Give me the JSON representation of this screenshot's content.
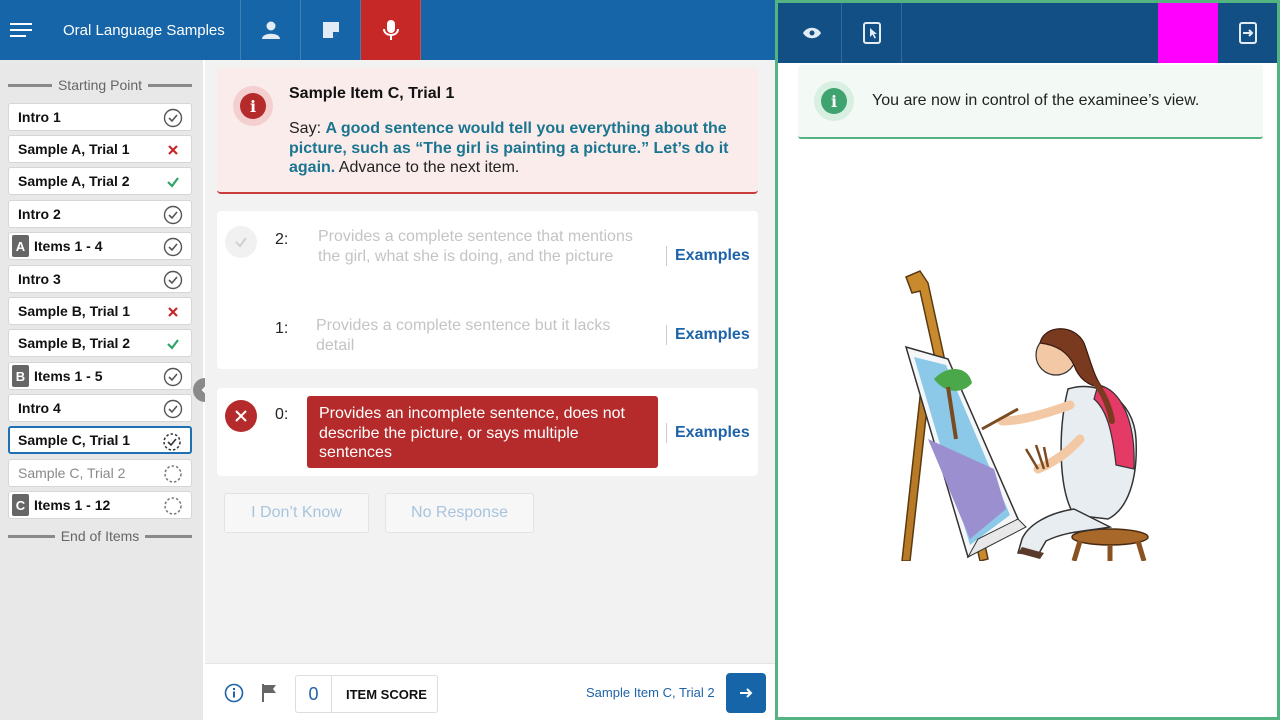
{
  "header": {
    "title": "Oral Language Samples",
    "colors": {
      "bar": "#1565a8",
      "active": "#c62828"
    }
  },
  "sidebar": {
    "start_label": "Starting Point",
    "end_label": "End of Items",
    "items": [
      {
        "label": "Intro 1",
        "letter": "",
        "status": "complete"
      },
      {
        "label": "Sample A, Trial 1",
        "letter": "",
        "status": "incorrect"
      },
      {
        "label": "Sample A, Trial 2",
        "letter": "",
        "status": "correct"
      },
      {
        "label": "Intro 2",
        "letter": "",
        "status": "complete"
      },
      {
        "label": "Items 1 - 4",
        "letter": "A",
        "status": "complete"
      },
      {
        "label": "Intro 3",
        "letter": "",
        "status": "complete"
      },
      {
        "label": "Sample B, Trial 1",
        "letter": "",
        "status": "incorrect"
      },
      {
        "label": "Sample B, Trial 2",
        "letter": "",
        "status": "correct"
      },
      {
        "label": "Items 1 - 5",
        "letter": "B",
        "status": "complete"
      },
      {
        "label": "Intro 4",
        "letter": "",
        "status": "complete"
      },
      {
        "label": "Sample C, Trial 1",
        "letter": "",
        "status": "current"
      },
      {
        "label": "Sample C, Trial 2",
        "letter": "",
        "status": "pending"
      },
      {
        "label": "Items 1 - 12",
        "letter": "C",
        "status": "pending"
      }
    ]
  },
  "alert": {
    "title": "Sample Item C, Trial 1",
    "say_prefix": "Say: ",
    "say_bold": "A good sentence would tell you everything about the picture, such as “The girl is painting a picture.” Let’s do it again.",
    "say_suffix": " Advance to the next item."
  },
  "scores": [
    {
      "score": "2:",
      "description": "Provides a complete sentence that mentions the girl, what she is doing, and the picture",
      "link": "Examples"
    },
    {
      "score": "1:",
      "description": "Provides a complete sentence but it lacks detail",
      "link": "Examples"
    },
    {
      "score": "0:",
      "description": "Provides an incomplete sentence, does not describe the picture, or says multiple sentences",
      "link": "Examples",
      "selected": true
    }
  ],
  "responses": {
    "dont_know": "I Don’t Know",
    "no_response": "No Response"
  },
  "footer": {
    "score_value": "0",
    "score_label": "ITEM SCORE",
    "next_item": "Sample Item C, Trial 2"
  },
  "examinee": {
    "alert_text": "You are now in control of the examinee’s view.",
    "colors": {
      "bar": "#124f85",
      "border": "#53b482",
      "highlight": "#ff00ff"
    }
  }
}
